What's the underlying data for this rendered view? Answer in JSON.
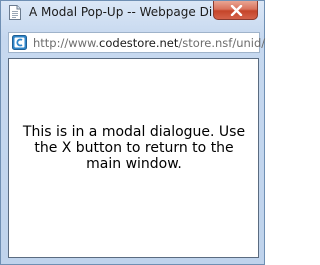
{
  "window": {
    "title": "A Modal Pop-Up -- Webpage Di..."
  },
  "address_bar": {
    "url_prefix": "http://www.",
    "url_host": "codestore.net",
    "url_suffix": "/store.nsf/unid/"
  },
  "content": {
    "message": "This is in a modal dialogue. Use the X button to return to the main window."
  },
  "icons": {
    "title_icon": "document-icon",
    "close_icon": "close-icon",
    "page_icon": "site-favicon-icon"
  },
  "colors": {
    "title_bar": "#c6d8ef",
    "close_button": "#c5452a",
    "content_bg": "#ffffff"
  }
}
